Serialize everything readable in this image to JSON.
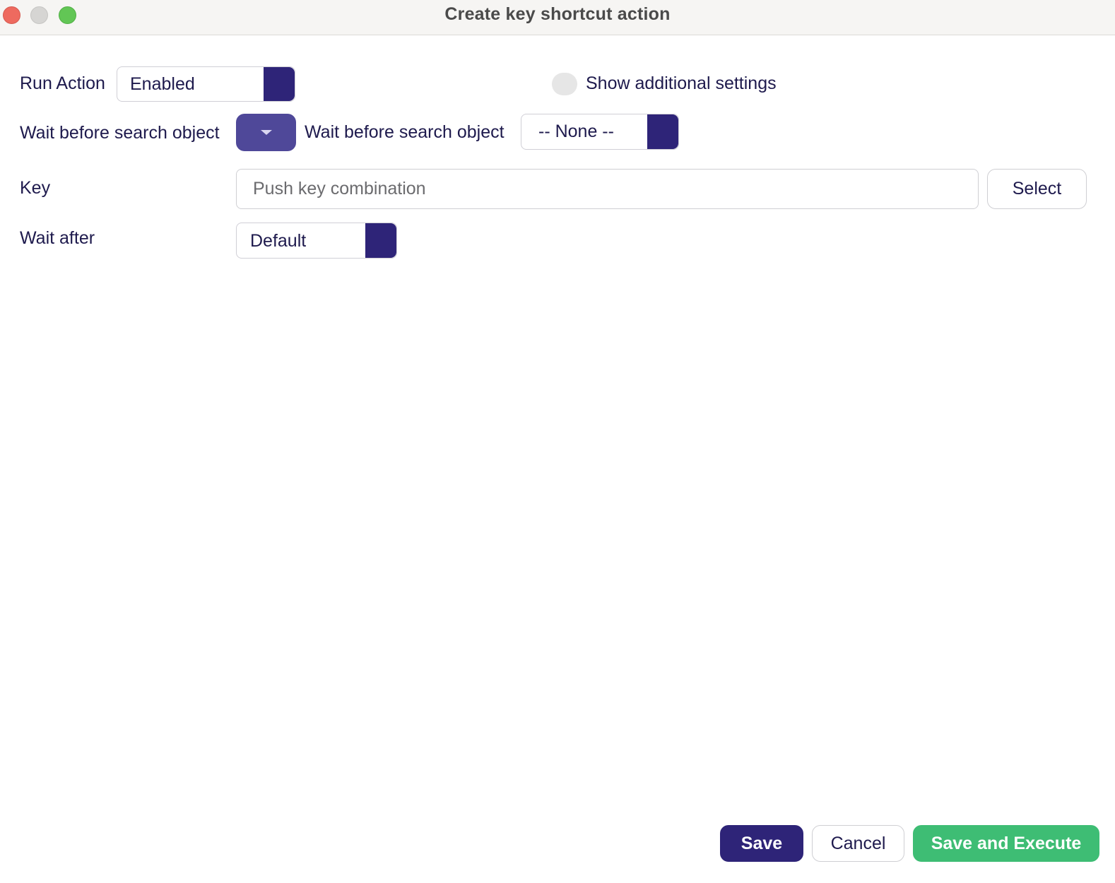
{
  "window": {
    "title": "Create key shortcut action"
  },
  "form": {
    "run_action": {
      "label": "Run Action",
      "value": "Enabled"
    },
    "additional_settings": {
      "label": "Show additional settings",
      "enabled": false
    },
    "wait_before_search": {
      "label": "Wait before search object",
      "second_label": "Wait before search object",
      "value": "-- None --"
    },
    "key": {
      "label": "Key",
      "placeholder": "Push key combination",
      "value": "",
      "select_label": "Select"
    },
    "wait_after": {
      "label": "Wait after",
      "value": "Default"
    }
  },
  "footer": {
    "save_label": "Save",
    "cancel_label": "Cancel",
    "execute_label": "Save and Execute"
  },
  "colors": {
    "primary": "#2e2478",
    "dropdown": "#4f4899",
    "success": "#3ebd74",
    "text": "#1e1a4d"
  }
}
